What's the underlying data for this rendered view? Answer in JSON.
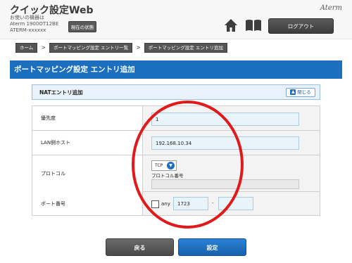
{
  "header": {
    "app_title": "クイック設定Web",
    "device_lines": [
      "お使いの機器は",
      "Aterm 1900OT12BE",
      "ATERM-xxxxxx"
    ],
    "status_button": "現在の状態",
    "brand": "Aterm",
    "home_icon": "home-icon",
    "manual_icon": "book-icon",
    "logout_button": "ログアウト"
  },
  "breadcrumb": {
    "items": [
      "ホーム",
      "ポートマッピング設定 エントリ一覧",
      "ポートマッピング設定 エントリ追加"
    ],
    "separator": ">"
  },
  "page": {
    "title": "ポートマッピング設定 エントリ追加"
  },
  "section": {
    "title": "NATエントリ追加",
    "close_button": "閉じる"
  },
  "form": {
    "priority": {
      "label": "優先度",
      "value": "1"
    },
    "lan_host": {
      "label": "LAN側ホスト",
      "value": "192.168.10.34"
    },
    "protocol": {
      "label": "プロトコル",
      "selected": "TCP",
      "number_label": "プロトコル番号",
      "number_value": ""
    },
    "port": {
      "label": "ポート番号",
      "any_label": "any",
      "any_checked": false,
      "from": "1723",
      "separator": "-",
      "to": ""
    }
  },
  "buttons": {
    "back": "戻る",
    "submit": "設定"
  },
  "colors": {
    "accent": "#1c6fbf",
    "annotation": "#e01a1a"
  }
}
